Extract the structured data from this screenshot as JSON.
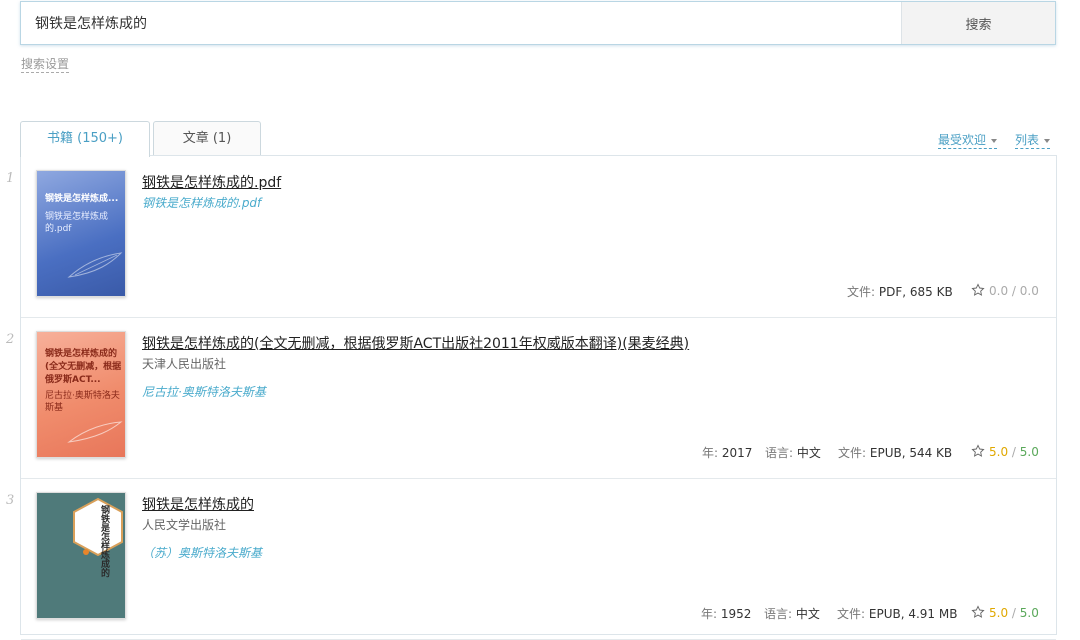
{
  "search": {
    "value": "钢铁是怎样炼成的",
    "button_label": "搜索",
    "settings_link": "搜索设置"
  },
  "tabs": [
    {
      "label": "书籍 (150+)",
      "active": true
    },
    {
      "label": "文章 (1)",
      "active": false
    }
  ],
  "sort": {
    "order_label": "最受欢迎",
    "view_label": "列表"
  },
  "labels": {
    "year": "年:",
    "language": "语言:",
    "file": "文件:",
    "rating_sep": "/"
  },
  "results": [
    {
      "index": "1",
      "title": "钢铁是怎样炼成的.pdf",
      "publisher": "",
      "author": "钢铁是怎样炼成的.pdf",
      "year": "",
      "language": "",
      "file": "PDF, 685 KB",
      "rating": "0.0",
      "rating_max": "0.0",
      "cover": {
        "title": "钢铁是怎样炼成...",
        "subtitle": "钢铁是怎样炼成的.pdf",
        "bg": "#4a6fc2",
        "text_color": "#ffffff"
      }
    },
    {
      "index": "2",
      "title": "钢铁是怎样炼成的(全文无删减，根据俄罗斯ACT出版社2011年权威版本翻译)(果麦经典)",
      "publisher": "天津人民出版社",
      "author": "尼古拉·奥斯特洛夫斯基",
      "year": "2017",
      "language": "中文",
      "file": "EPUB, 544 KB",
      "rating": "5.0",
      "rating_max": "5.0",
      "cover": {
        "title": "钢铁是怎样炼成的(全文无删减，根据俄罗斯ACT...",
        "subtitle": "尼古拉·奥斯特洛夫斯基",
        "bg": "#f08c6c",
        "text_color": "#8a2a1a"
      }
    },
    {
      "index": "3",
      "title": "钢铁是怎样炼成的",
      "publisher": "人民文学出版社",
      "author": "（苏）奥斯特洛夫斯基",
      "year": "1952",
      "language": "中文",
      "file": "EPUB, 4.91 MB",
      "rating": "5.0",
      "rating_max": "5.0",
      "cover": {
        "title": "钢铁是怎样炼成的",
        "subtitle": "",
        "bg": "#4f7a7a",
        "text_color": "#2b2b2b"
      }
    }
  ],
  "colors": {
    "accent": "#4a9fc4",
    "rating_gold": "#e0a800",
    "rating_green": "#5aa85a",
    "rating_grey": "#aaaaaa"
  }
}
